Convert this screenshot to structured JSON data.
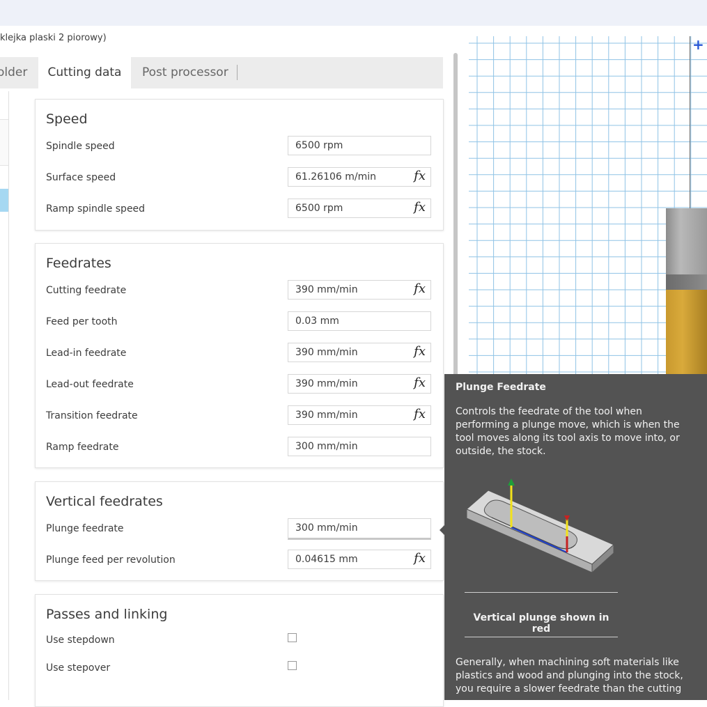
{
  "window": {
    "doc_title": "klejka plaski 2 piorowy)"
  },
  "tabs": [
    {
      "label": "older"
    },
    {
      "label": "Cutting data"
    },
    {
      "label": "Post processor"
    }
  ],
  "sections": {
    "speed": {
      "title": "Speed",
      "rows": [
        {
          "label": "Spindle speed",
          "value": "6500 rpm"
        },
        {
          "label": "Surface speed",
          "value": "61.26106 m/min",
          "fx": "fx"
        },
        {
          "label": "Ramp spindle speed",
          "value": "6500 rpm",
          "fx": "fx"
        }
      ]
    },
    "feedrates": {
      "title": "Feedrates",
      "rows": [
        {
          "label": "Cutting feedrate",
          "value": "390 mm/min",
          "fx": "fx"
        },
        {
          "label": "Feed per tooth",
          "value": "0.03 mm"
        },
        {
          "label": "Lead-in feedrate",
          "value": "390 mm/min",
          "fx": "fx"
        },
        {
          "label": "Lead-out feedrate",
          "value": "390 mm/min",
          "fx": "fx"
        },
        {
          "label": "Transition feedrate",
          "value": "390 mm/min",
          "fx": "fx"
        },
        {
          "label": "Ramp feedrate",
          "value": "300 mm/min"
        }
      ]
    },
    "vertical": {
      "title": "Vertical feedrates",
      "rows": [
        {
          "label": "Plunge feedrate",
          "value": "300 mm/min"
        },
        {
          "label": "Plunge feed per revolution",
          "value": "0.04615 mm",
          "fx": "fx"
        }
      ]
    },
    "passes": {
      "title": "Passes and linking",
      "rows": [
        {
          "label": "Use stepdown",
          "checked": false
        },
        {
          "label": "Use stepover",
          "checked": false
        }
      ]
    }
  },
  "tooltip": {
    "title": "Plunge Feedrate",
    "body": "Controls the feedrate of the tool when performing a plunge move, which is when the tool moves along its tool axis to move into, or outside, the stock.",
    "caption": "Vertical plunge shown in red",
    "footer": "Generally, when machining soft materials like plastics and wood and plunging into the stock, you require a slower feedrate than the cutting"
  },
  "colors": {
    "grid_line": "#8fc3e6",
    "tool_body": "#d4a436",
    "tooltip_bg": "#535353",
    "selected_strip": "#a6d8f2"
  }
}
